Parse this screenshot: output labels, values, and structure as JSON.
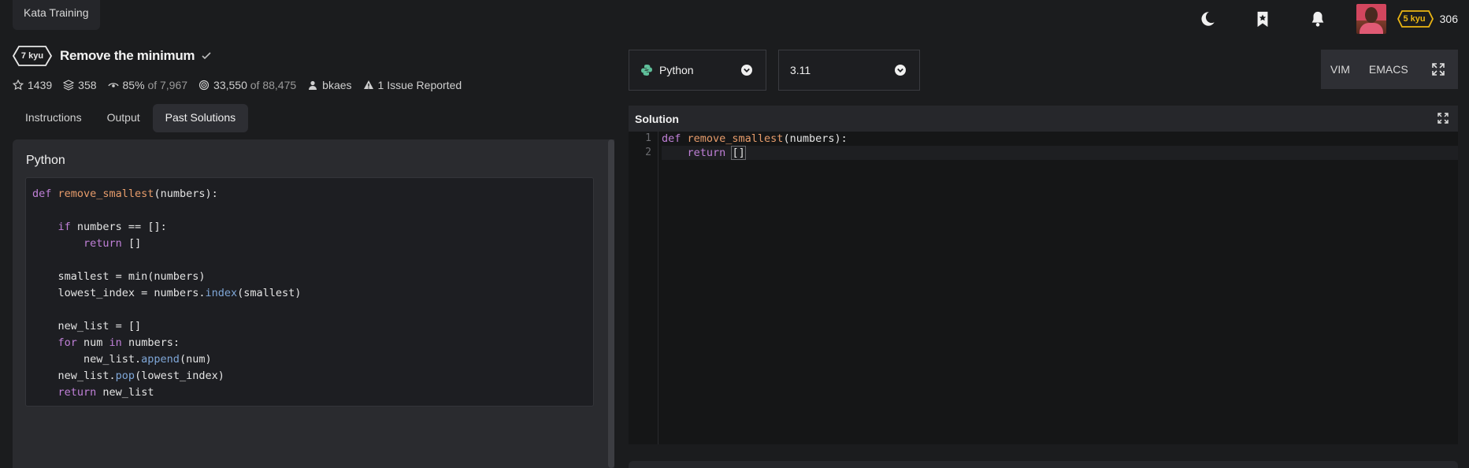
{
  "topbar": {
    "title": "Kata Training",
    "rank": "5 kyu",
    "honor": "306",
    "icons": [
      "moon-icon",
      "bookmark-star-icon",
      "bell-icon"
    ]
  },
  "kata": {
    "rank": "7 kyu",
    "name": "Remove the minimum",
    "stats": {
      "stars": "1439",
      "collections": "358",
      "satisfaction": "85%",
      "satisfaction_of": "of 7,967",
      "completed": "33,550",
      "completed_of": "of 88,475",
      "author": "bkaes",
      "issues": "1 Issue Reported"
    }
  },
  "tabs": [
    {
      "label": "Instructions",
      "active": false
    },
    {
      "label": "Output",
      "active": false
    },
    {
      "label": "Past Solutions",
      "active": true
    }
  ],
  "past_solution": {
    "language": "Python",
    "code_lines": [
      [
        [
          "kw",
          "def "
        ],
        [
          "fn",
          "remove_smallest"
        ],
        [
          "",
          "(numbers):"
        ]
      ],
      [],
      [
        [
          "",
          "    "
        ],
        [
          "kw",
          "if"
        ],
        [
          "",
          " numbers == []:"
        ]
      ],
      [
        [
          "",
          "        "
        ],
        [
          "kw",
          "return"
        ],
        [
          "",
          " []"
        ]
      ],
      [],
      [
        [
          "",
          "    smallest = min(numbers)"
        ]
      ],
      [
        [
          "",
          "    lowest_index = numbers."
        ],
        [
          "meth",
          "index"
        ],
        [
          "",
          "(smallest)"
        ]
      ],
      [],
      [
        [
          "",
          "    new_list = []"
        ]
      ],
      [
        [
          "",
          "    "
        ],
        [
          "kw",
          "for"
        ],
        [
          "",
          " num "
        ],
        [
          "kw",
          "in"
        ],
        [
          "",
          " numbers:"
        ]
      ],
      [
        [
          "",
          "        new_list."
        ],
        [
          "meth",
          "append"
        ],
        [
          "",
          "(num)"
        ]
      ],
      [
        [
          "",
          "    new_list."
        ],
        [
          "meth",
          "pop"
        ],
        [
          "",
          "(lowest_index)"
        ]
      ],
      [
        [
          "",
          "    "
        ],
        [
          "kw",
          "return"
        ],
        [
          "",
          " new_list"
        ]
      ]
    ]
  },
  "editor": {
    "language_select": "Python",
    "version_select": "3.11",
    "keymap_buttons": [
      "VIM",
      "EMACS"
    ],
    "header": "Solution",
    "line_numbers": [
      "1",
      "2"
    ],
    "code_lines": [
      [
        [
          "kw",
          "def "
        ],
        [
          "fn",
          "remove_smallest"
        ],
        [
          "",
          "(numbers):"
        ]
      ],
      [
        [
          "",
          "    "
        ],
        [
          "kw",
          "return"
        ],
        [
          "",
          " "
        ],
        [
          "hl",
          "[]"
        ]
      ]
    ]
  },
  "colors": {
    "background": "#1b1c1e",
    "rank_yellow": "#ecb613",
    "keyword": "#c080d8",
    "function": "#e79c6b",
    "method": "#7fa7d8"
  }
}
